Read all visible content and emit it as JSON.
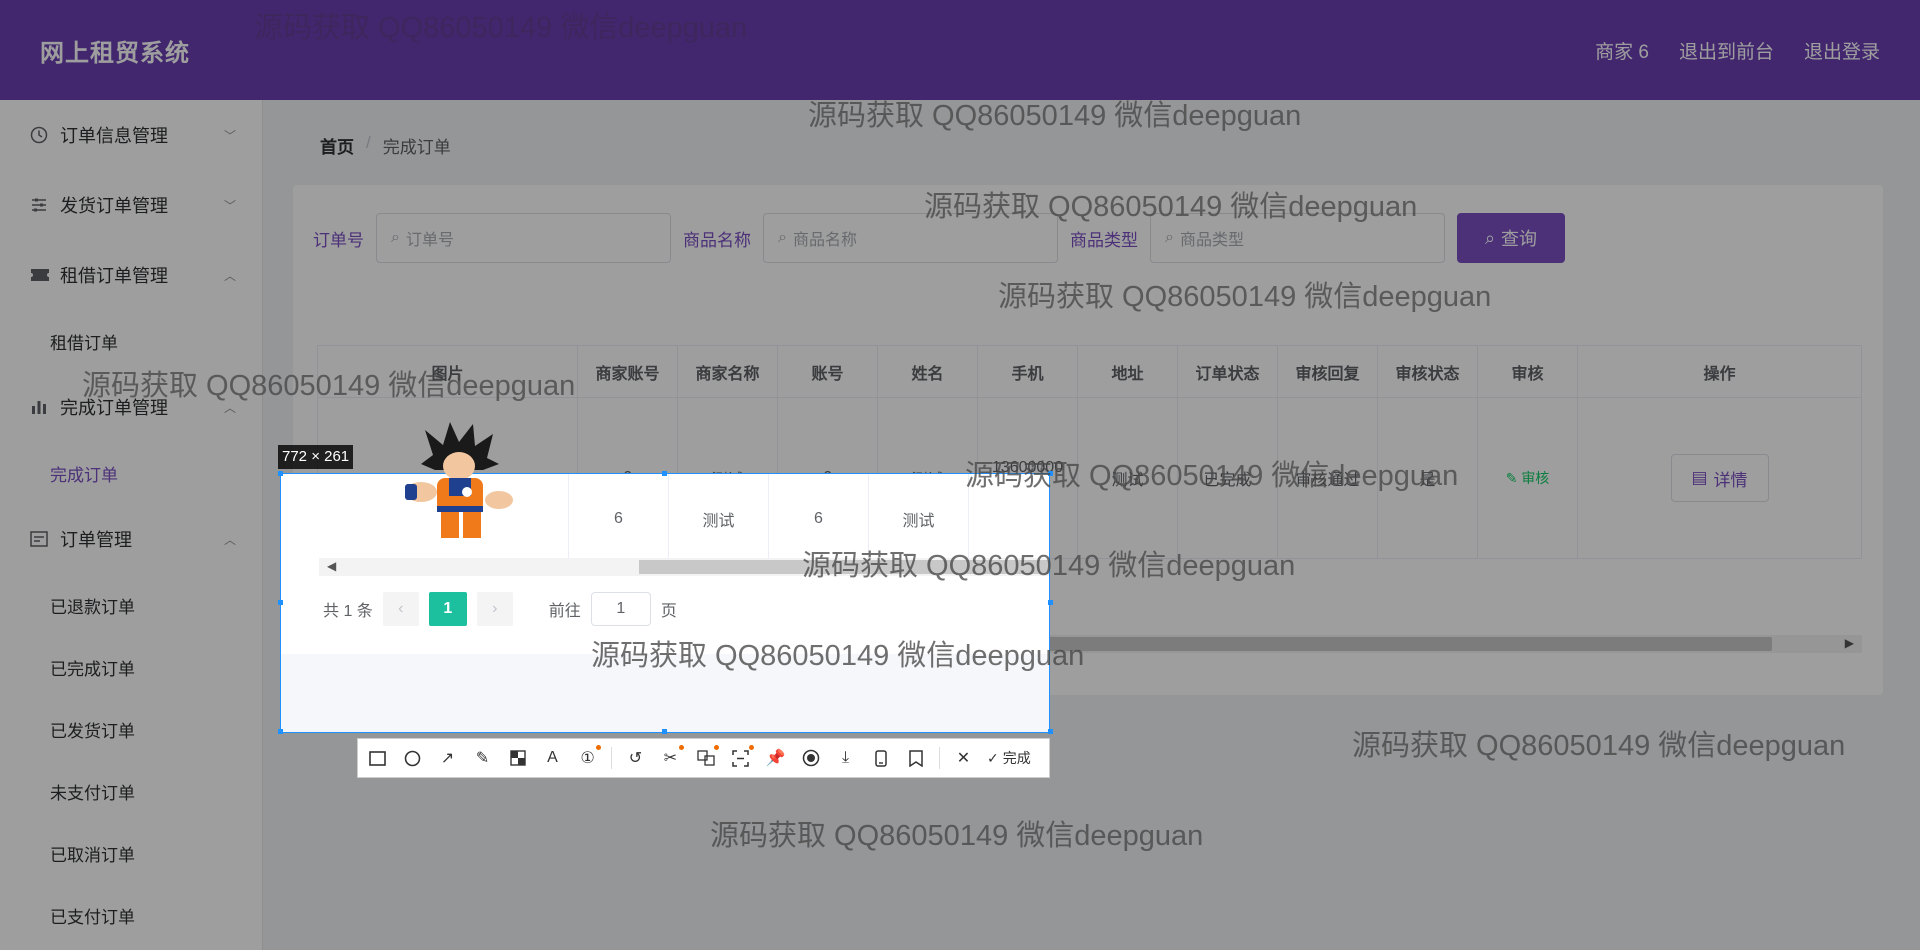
{
  "header": {
    "brand": "网上租贸系统",
    "nav": [
      "商家 6",
      "退出到前台",
      "退出登录"
    ]
  },
  "sidebar": {
    "groups": [
      {
        "label": "订单信息管理",
        "icon": "clock-icon",
        "arrow": "﹀",
        "items": []
      },
      {
        "label": "发货订单管理",
        "icon": "sliders-icon",
        "arrow": "﹀",
        "items": []
      },
      {
        "label": "租借订单管理",
        "icon": "ticket-icon",
        "arrow": "︿",
        "items": [
          "租借订单"
        ]
      },
      {
        "label": "完成订单管理",
        "icon": "bar-chart-icon",
        "arrow": "︿",
        "items": [
          "完成订单"
        ]
      },
      {
        "label": "订单管理",
        "icon": "list-icon",
        "arrow": "︿",
        "items": [
          "已退款订单",
          "已完成订单",
          "已发货订单",
          "未支付订单",
          "已取消订单",
          "已支付订单"
        ]
      }
    ],
    "active_item": "完成订单"
  },
  "breadcrumb": {
    "home": "首页",
    "sep": "/",
    "current": "完成订单"
  },
  "search": {
    "fields": [
      {
        "label": "订单号",
        "placeholder": "订单号"
      },
      {
        "label": "商品名称",
        "placeholder": "商品名称"
      },
      {
        "label": "商品类型",
        "placeholder": "商品类型"
      }
    ],
    "button": "查询"
  },
  "table": {
    "columns": [
      "图片",
      "商家账号",
      "商家名称",
      "账号",
      "姓名",
      "手机",
      "地址",
      "订单状态",
      "审核回复",
      "审核状态",
      "审核",
      "操作"
    ],
    "row": {
      "merchant_account": "6",
      "merchant_name": "测试",
      "account": "6",
      "name": "测试",
      "phone": "13600000000",
      "address": "测试",
      "order_status": "已完成",
      "review_reply": "审核通过",
      "review_status": "是",
      "review_link": "审核",
      "detail_button": "详情"
    }
  },
  "pagination": {
    "total_label": "共 1 条",
    "current_page": "1",
    "goto_label": "前往",
    "goto_value": "1",
    "page_unit": "页"
  },
  "screenshot_tool": {
    "size_label": "772 × 261",
    "done_label": "完成",
    "tools": [
      "rectangle-icon",
      "circle-icon",
      "arrow-icon",
      "pen-icon",
      "mosaic-icon",
      "text-icon",
      "number-icon",
      "undo-icon",
      "scissors-icon",
      "translate-icon",
      "ocr-icon",
      "pin-icon",
      "record-icon",
      "download-icon",
      "phone-icon",
      "bookmark-icon",
      "close-icon"
    ]
  },
  "watermark": "源码获取 QQ86050149 微信deepguan"
}
